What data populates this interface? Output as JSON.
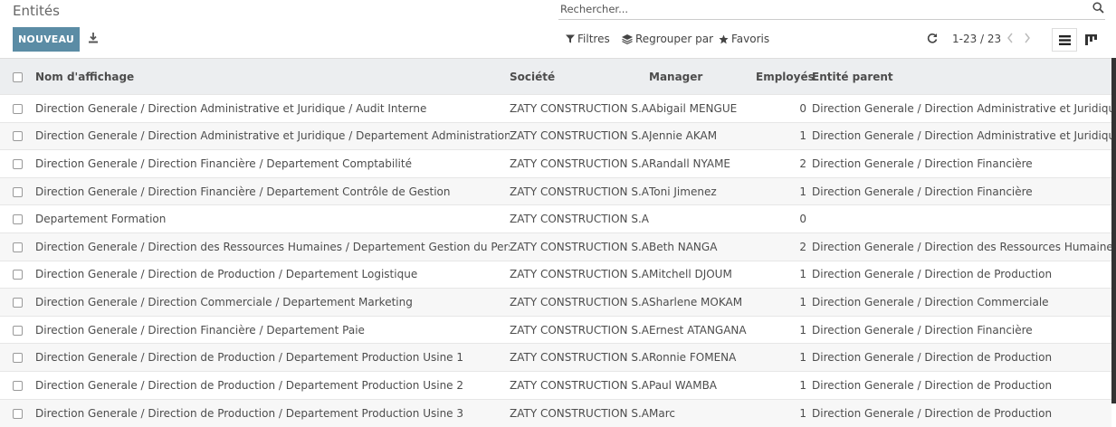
{
  "header": {
    "title": "Entités",
    "new_button": "NOUVEAU"
  },
  "search": {
    "placeholder": "Rechercher..."
  },
  "filters": {
    "filters_label": "Filtres",
    "group_by_label": "Regrouper par",
    "favorites_label": "Favoris"
  },
  "pager": {
    "value": "1-23 / 23"
  },
  "table": {
    "columns": {
      "name": "Nom d'affichage",
      "company": "Société",
      "manager": "Manager",
      "employees": "Employés",
      "parent": "Entité parent"
    },
    "rows": [
      {
        "name": "Direction Generale / Direction Administrative et Juridique / Audit Interne",
        "company": "ZATY CONSTRUCTION S.A.",
        "manager": "Abigail MENGUE",
        "employees": "0",
        "parent": "Direction Generale / Direction Administrative et Juridique"
      },
      {
        "name": "Direction Generale / Direction Administrative et Juridique / Departement Administration",
        "company": "ZATY CONSTRUCTION S.A.",
        "manager": "Jennie AKAM",
        "employees": "1",
        "parent": "Direction Generale / Direction Administrative et Juridique"
      },
      {
        "name": "Direction Generale / Direction Financière / Departement Comptabilité",
        "company": "ZATY CONSTRUCTION S.A.",
        "manager": "Randall NYAME",
        "employees": "2",
        "parent": "Direction Generale / Direction Financière"
      },
      {
        "name": "Direction Generale / Direction Financière / Departement Contrôle de Gestion",
        "company": "ZATY CONSTRUCTION S.A.",
        "manager": "Toni Jimenez",
        "employees": "1",
        "parent": "Direction Generale / Direction Financière"
      },
      {
        "name": "Departement Formation",
        "company": "ZATY CONSTRUCTION S.A.",
        "manager": "",
        "employees": "0",
        "parent": ""
      },
      {
        "name": "Direction Generale / Direction des Ressources Humaines / Departement Gestion du Personnel",
        "company": "ZATY CONSTRUCTION S.A.",
        "manager": "Beth NANGA",
        "employees": "2",
        "parent": "Direction Generale / Direction des Ressources Humaines"
      },
      {
        "name": "Direction Generale / Direction de Production / Departement Logistique",
        "company": "ZATY CONSTRUCTION S.A.",
        "manager": "Mitchell DJOUM",
        "employees": "1",
        "parent": "Direction Generale / Direction de Production"
      },
      {
        "name": "Direction Generale / Direction Commerciale / Departement Marketing",
        "company": "ZATY CONSTRUCTION S.A.",
        "manager": "Sharlene MOKAM",
        "employees": "1",
        "parent": "Direction Generale / Direction Commerciale"
      },
      {
        "name": "Direction Generale / Direction Financière / Departement Paie",
        "company": "ZATY CONSTRUCTION S.A.",
        "manager": "Ernest ATANGANA",
        "employees": "1",
        "parent": "Direction Generale / Direction Financière"
      },
      {
        "name": "Direction Generale / Direction de Production / Departement Production Usine 1",
        "company": "ZATY CONSTRUCTION S.A.",
        "manager": "Ronnie FOMENA",
        "employees": "1",
        "parent": "Direction Generale / Direction de Production"
      },
      {
        "name": "Direction Generale / Direction de Production / Departement Production Usine 2",
        "company": "ZATY CONSTRUCTION S.A.",
        "manager": "Paul WAMBA",
        "employees": "1",
        "parent": "Direction Generale / Direction de Production"
      },
      {
        "name": "Direction Generale / Direction de Production / Departement Production Usine 3",
        "company": "ZATY CONSTRUCTION S.A.",
        "manager": "Marc",
        "employees": "1",
        "parent": "Direction Generale / Direction de Production"
      }
    ]
  },
  "icons": {
    "download": "download-icon",
    "search": "search-icon",
    "filter": "filter-icon",
    "group_by": "layers-icon",
    "favorites": "star-icon",
    "refresh": "refresh-icon",
    "prev": "chevron-left-icon",
    "next": "chevron-right-icon",
    "list_view": "list-view-icon",
    "kanban_view": "kanban-view-icon"
  },
  "colors": {
    "primary_button": "#5b8ca5",
    "header_row": "#eceef0"
  }
}
